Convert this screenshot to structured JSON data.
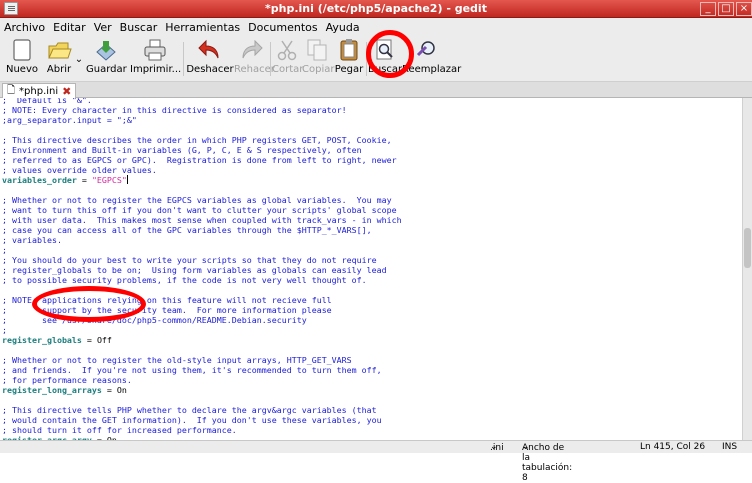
{
  "window": {
    "title": "*php.ini (/etc/php5/apache2) - gedit"
  },
  "menu": [
    "Archivo",
    "Editar",
    "Ver",
    "Buscar",
    "Herramientas",
    "Documentos",
    "Ayuda"
  ],
  "toolbar": {
    "nuevo": "Nuevo",
    "abrir": "Abrir",
    "guardar": "Guardar",
    "imprimir": "Imprimir...",
    "deshacer": "Deshacer",
    "rehacer": "Rehacer",
    "cortar": "Cortar",
    "copiar": "Copiar",
    "pegar": "Pegar",
    "buscar": "Buscar",
    "reemplazar": "Reemplazar"
  },
  "tab": {
    "label": "*php.ini"
  },
  "code_lines": [
    ";  Default is \"&\".",
    "; NOTE: Every character in this directive is considered as separator!",
    ";arg_separator.input = \";&\"",
    "",
    "; This directive describes the order in which PHP registers GET, POST, Cookie,",
    "; Environment and Built-in variables (G, P, C, E & S respectively, often",
    "; referred to as EGPCS or GPC).  Registration is done from left to right, newer",
    "; values override older values.",
    "variables_order = \"EGPCS\"",
    "",
    "; Whether or not to register the EGPCS variables as global variables.  You may",
    "; want to turn this off if you don't want to clutter your scripts' global scope",
    "; with user data.  This makes most sense when coupled with track_vars - in which",
    "; case you can access all of the GPC variables through the $HTTP_*_VARS[],",
    "; variables.",
    ";",
    "; You should do your best to write your scripts so that they do not require",
    "; register_globals to be on;  Using form variables as globals can easily lead",
    "; to possible security problems, if the code is not very well thought of.",
    "",
    "; NOTE: applications relying on this feature will not recieve full",
    ";       support by the security team.  For more information please",
    ";       see /usr/share/doc/php5-common/README.Debian.security",
    ";",
    "register_globals = Off",
    "",
    "; Whether or not to register the old-style input arrays, HTTP_GET_VARS",
    "; and friends.  If you're not using them, it's recommended to turn them off,",
    "; for performance reasons.",
    "register_long_arrays = On",
    "",
    "; This directive tells PHP whether to declare the argv&argc variables (that",
    "; would contain the GET information).  If you don't use these variables, you",
    "; should turn it off for increased performance.",
    "register_argc_argv = On"
  ],
  "status": {
    "lang": ".ini",
    "tab_width": "Ancho de la tabulación: 8",
    "position": "Ln 415, Col 26",
    "mode": "INS"
  }
}
